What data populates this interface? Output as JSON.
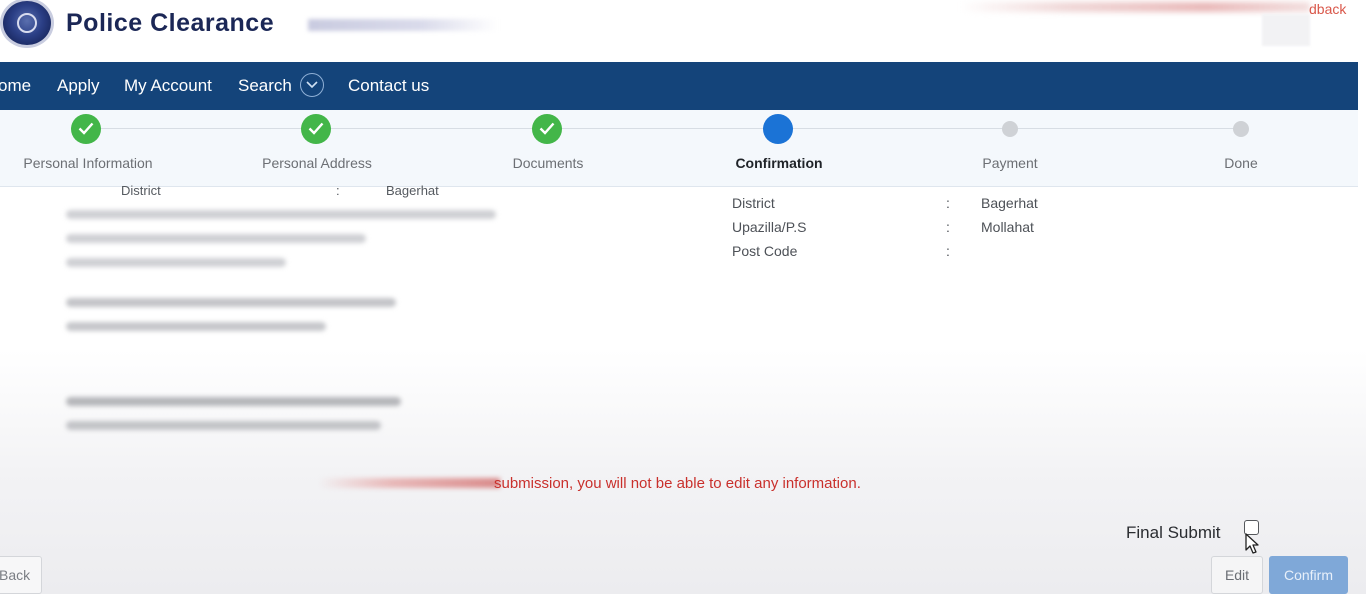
{
  "header": {
    "title": "Police Clearance",
    "feedback_partial": "dback"
  },
  "nav": {
    "items": [
      "ome",
      "Apply",
      "My Account",
      "Search",
      "Contact us"
    ]
  },
  "stepper": {
    "steps": [
      {
        "label": "Personal Information",
        "status": "done"
      },
      {
        "label": "Personal Address",
        "status": "done"
      },
      {
        "label": "Documents",
        "status": "done"
      },
      {
        "label": "Confirmation",
        "status": "current"
      },
      {
        "label": "Payment",
        "status": "pending"
      },
      {
        "label": "Done",
        "status": "pending"
      }
    ],
    "colors": {
      "done": "#43b649",
      "current": "#1b73d6",
      "pending": "#cfd2d6"
    }
  },
  "cut_row": {
    "label": "District",
    "colon": ":",
    "value": "Bagerhat"
  },
  "address_info": [
    {
      "label": "District",
      "colon": ":",
      "value": "Bagerhat"
    },
    {
      "label": "Upazilla/P.S",
      "colon": ":",
      "value": "Mollahat"
    },
    {
      "label": "Post Code",
      "colon": ":",
      "value": ""
    }
  ],
  "warning": {
    "text": "submission, you will not be able to edit any information.",
    "color": "#c9302c"
  },
  "final_submit": {
    "label": "Final Submit",
    "checked": false
  },
  "buttons": {
    "back": "Back",
    "edit": "Edit",
    "confirm": "Confirm"
  },
  "brand": {
    "nav_color": "#14447a",
    "title_color": "#1b2756"
  }
}
